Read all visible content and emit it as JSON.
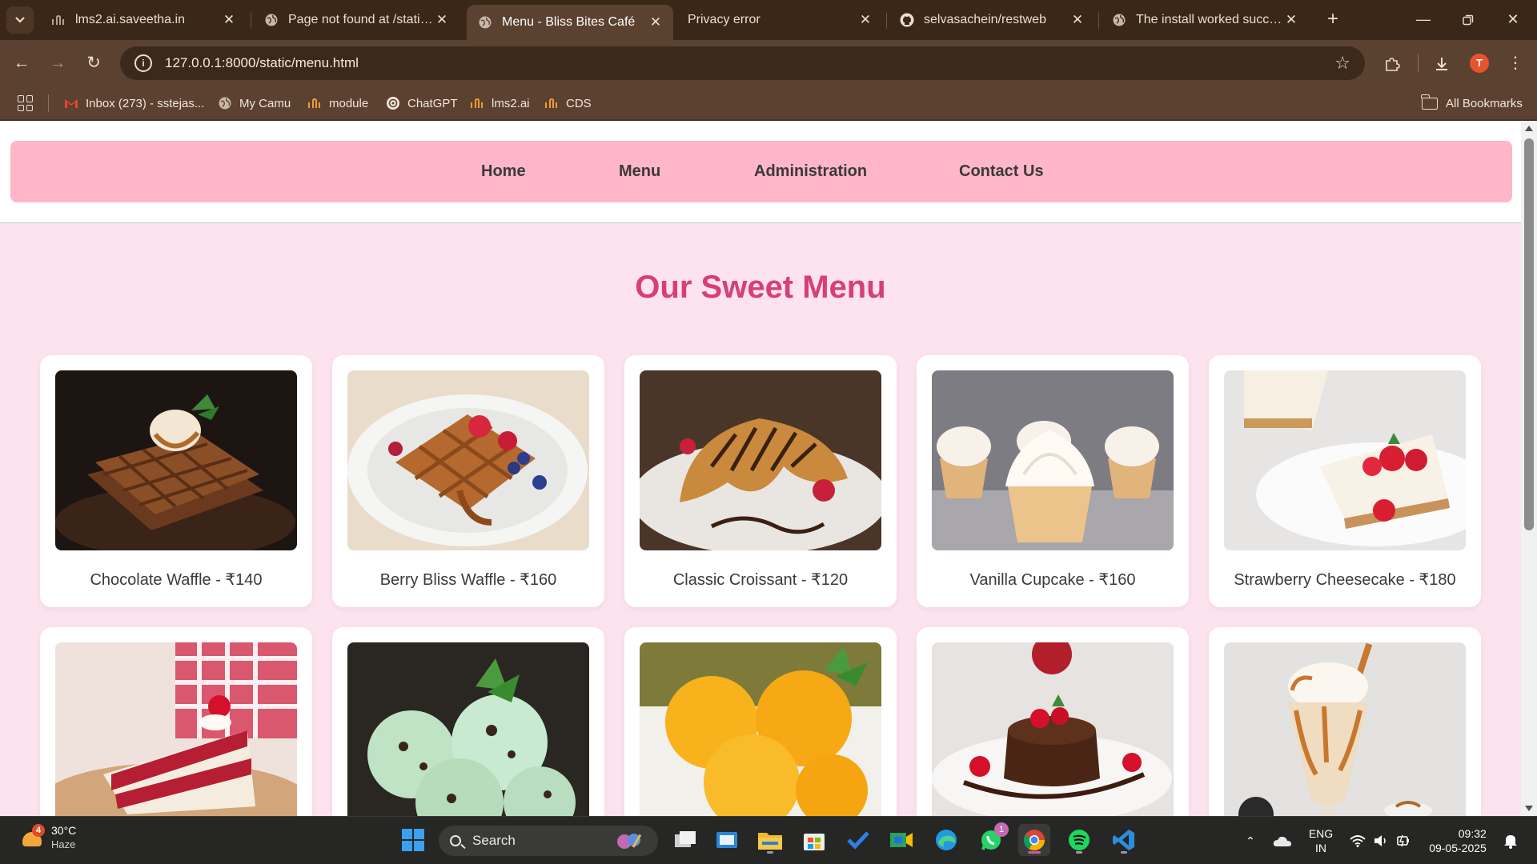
{
  "browser": {
    "tabs": [
      {
        "title": "lms2.ai.saveetha.in",
        "icon": "lms-icon",
        "active": false
      },
      {
        "title": "Page not found at /static/index.html",
        "icon": "globe-icon",
        "active": false
      },
      {
        "title": "Menu - Bliss Bites Café",
        "icon": "globe-icon",
        "active": true
      },
      {
        "title": "Privacy error",
        "icon": "none",
        "active": false
      },
      {
        "title": "selvasachein/restweb",
        "icon": "github-icon",
        "active": false
      },
      {
        "title": "The install worked successfully!",
        "icon": "globe-icon",
        "active": false
      }
    ],
    "url": "127.0.0.1:8000/static/menu.html",
    "profile_initial": "T",
    "bookmarks": [
      {
        "label": "Inbox (273) - sstejas...",
        "icon": "gmail-icon"
      },
      {
        "label": "My Camu",
        "icon": "globe-icon"
      },
      {
        "label": "module",
        "icon": "lms-icon"
      },
      {
        "label": "ChatGPT",
        "icon": "chatgpt-icon"
      },
      {
        "label": "lms2.ai",
        "icon": "lms-icon"
      },
      {
        "label": "CDS",
        "icon": "lms-icon"
      }
    ],
    "all_bookmarks_label": "All Bookmarks"
  },
  "site": {
    "nav": [
      "Home",
      "Menu",
      "Administration",
      "Contact Us"
    ],
    "title": "Our Sweet Menu",
    "items": [
      {
        "label": "Chocolate Waffle - ₹140",
        "image": "chocolate-waffle"
      },
      {
        "label": "Berry Bliss Waffle - ₹160",
        "image": "berry-waffle"
      },
      {
        "label": "Classic Croissant - ₹120",
        "image": "croissant"
      },
      {
        "label": "Vanilla Cupcake - ₹160",
        "image": "cupcake"
      },
      {
        "label": "Strawberry Cheesecake - ₹180",
        "image": "cheesecake"
      },
      {
        "label": "",
        "image": "red-velvet-cake"
      },
      {
        "label": "",
        "image": "mint-ice-cream"
      },
      {
        "label": "",
        "image": "mango-sorbet"
      },
      {
        "label": "",
        "image": "lava-cake"
      },
      {
        "label": "",
        "image": "milkshake"
      }
    ]
  },
  "colors": {
    "navbar_bg": "#ffb6c8",
    "page_bg": "#fde3ee",
    "title": "#d63f79"
  },
  "taskbar": {
    "weather_temp": "30°C",
    "weather_desc": "Haze",
    "weather_badge": "4",
    "search_label": "Search",
    "whatsapp_badge": "1",
    "lang_top": "ENG",
    "lang_bottom": "IN",
    "time": "09:32",
    "date": "09-05-2025"
  }
}
